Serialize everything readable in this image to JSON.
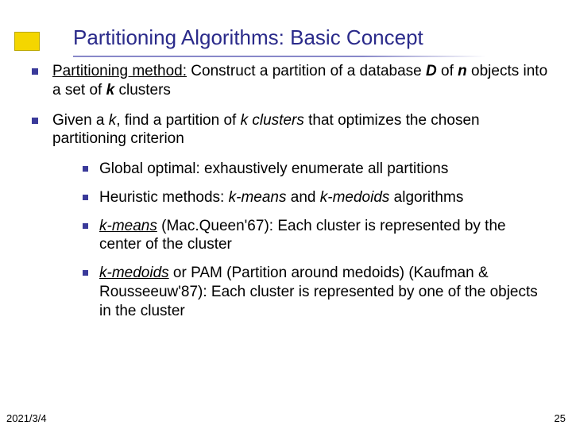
{
  "title": "Partitioning Algorithms: Basic Concept",
  "bullets": {
    "b1": {
      "lead_u": "Partitioning method:",
      "txt1": " Construct a partition of a database ",
      "D": "D",
      "txt2": " of ",
      "n": "n",
      "txt3": " objects into a set of ",
      "k": "k",
      "txt4": " clusters"
    },
    "b2": {
      "txt1": "Given a ",
      "k1": "k",
      "txt2": ", find a partition of ",
      "kcl": "k clusters",
      "txt3": " that optimizes the chosen partitioning criterion"
    },
    "sub": {
      "s1": "Global optimal: exhaustively enumerate all partitions",
      "s2": {
        "txt1": "Heuristic methods: ",
        "km": "k-means",
        "and": " and ",
        "kmed": "k-medoids",
        "tail": " algorithms"
      },
      "s3": {
        "km": "k-means",
        "txt": " (Mac.Queen'67): Each cluster is represented by the center of the cluster"
      },
      "s4": {
        "kmed": "k-medoids",
        "txt": " or PAM (Partition around medoids) (Kaufman & Rousseeuw'87): Each cluster is represented by one of the objects in the cluster"
      }
    }
  },
  "footer": {
    "date": "2021/3/4",
    "page": "25"
  }
}
